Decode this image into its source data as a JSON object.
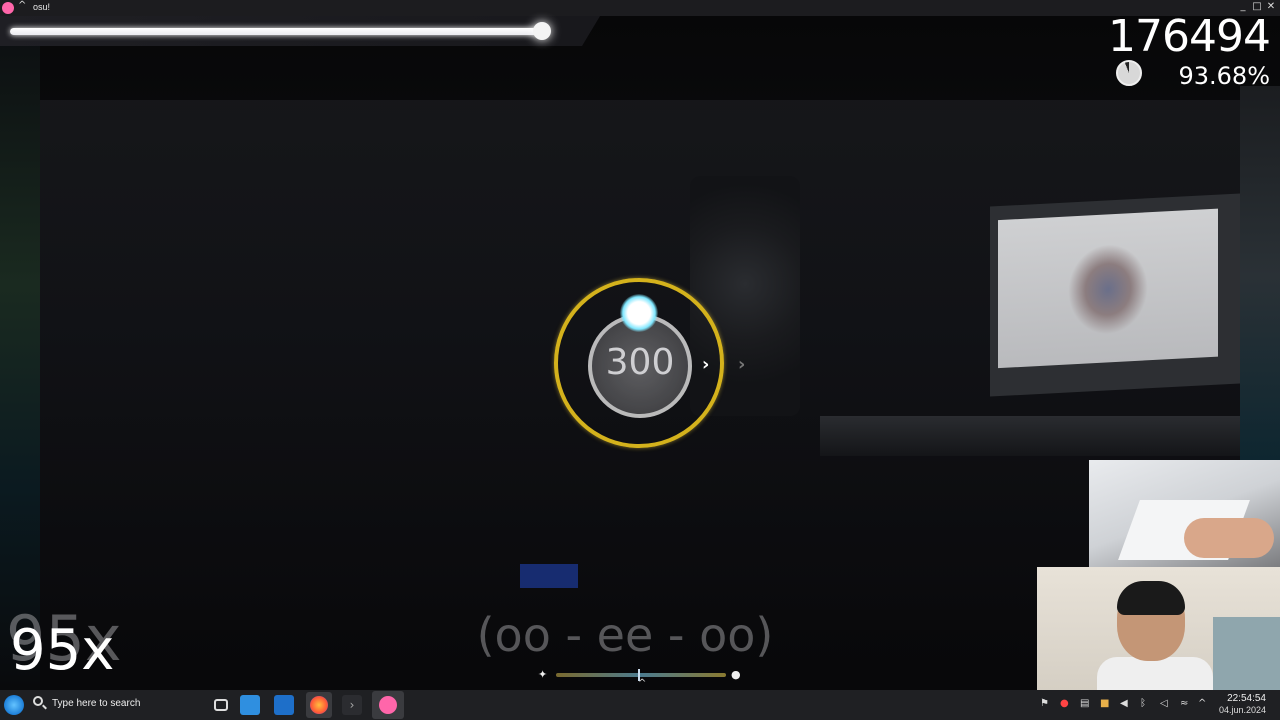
{
  "window": {
    "title": "osu!",
    "controls": [
      "_",
      "□",
      "✕"
    ]
  },
  "hud": {
    "score": "176494",
    "accuracy": "93.68%",
    "combo": "95x",
    "combo_ghost": "95x",
    "health_fraction": 0.95,
    "song_progress_fraction": 0.48
  },
  "hit_object": {
    "number": "300"
  },
  "lyrics": {
    "line": "(oo - ee - oo)"
  },
  "taskbar": {
    "search_placeholder": "Type here to search",
    "time": "22:54:54",
    "date": "04.jun.2024"
  },
  "colors": {
    "approach_circle": "#d4b21c",
    "cursor_glow": "#7fe7ff",
    "osu_pink": "#ff66aa"
  }
}
